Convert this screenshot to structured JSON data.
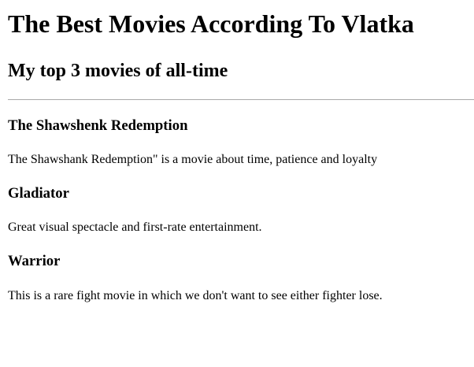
{
  "page": {
    "title": "The Best Movies According To Vlatka",
    "subtitle": "My top 3 movies of all-time"
  },
  "movies": [
    {
      "title": "The Shawshenk Redemption",
      "description": "The Shawshank Redemption\" is a movie about time, patience and loyalty"
    },
    {
      "title": "Gladiator",
      "description": "Great visual spectacle and first-rate entertainment."
    },
    {
      "title": "Warrior",
      "description": "This is a rare fight movie in which we don't want to see either fighter lose."
    }
  ]
}
